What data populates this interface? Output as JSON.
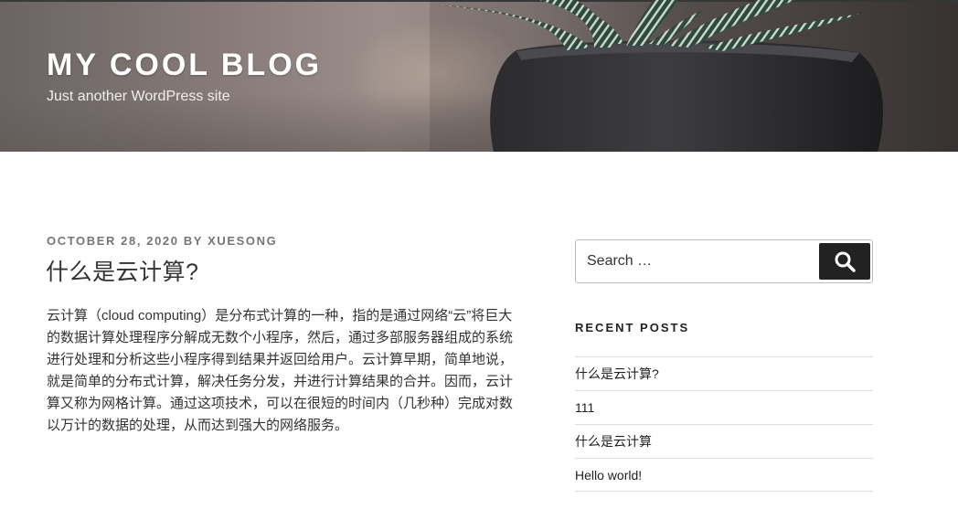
{
  "header": {
    "site_title": "MY COOL BLOG",
    "site_description": "Just another WordPress site"
  },
  "post": {
    "date": "OCTOBER 28, 2020",
    "by": "BY",
    "author": "XUESONG",
    "title": "什么是云计算?",
    "body": "云计算（cloud computing）是分布式计算的一种，指的是通过网络“云”将巨大的数据计算处理程序分解成无数个小程序，然后，通过多部服务器组成的系统进行处理和分析这些小程序得到结果并返回给用户。云计算早期，简单地说，就是简单的分布式计算，解决任务分发，并进行计算结果的合并。因而，云计算又称为网格计算。通过这项技术，可以在很短的时间内（几秒种）完成对数以万计的数据的处理，从而达到强大的网络服务。"
  },
  "sidebar": {
    "search": {
      "placeholder": "Search …",
      "button_icon": "search-icon"
    },
    "recent_posts": {
      "title": "RECENT POSTS",
      "items": [
        {
          "label": "什么是云计算?"
        },
        {
          "label": "111"
        },
        {
          "label": "什么是云计算"
        },
        {
          "label": "Hello world!"
        }
      ]
    }
  },
  "colors": {
    "button_bg": "#222222",
    "meta_text": "#767676"
  }
}
